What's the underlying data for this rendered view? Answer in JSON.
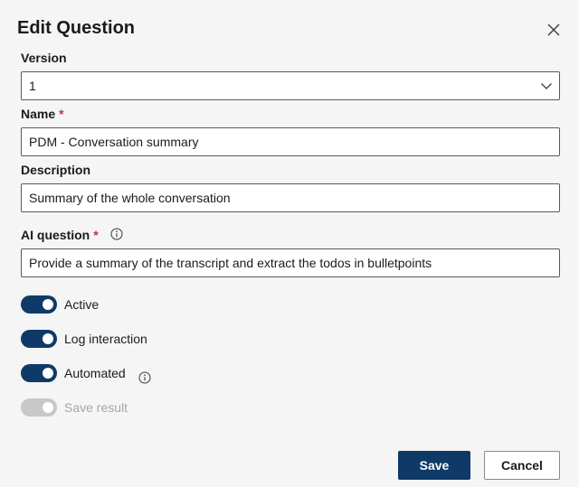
{
  "dialog": {
    "title": "Edit Question",
    "close_icon": "close-icon"
  },
  "version": {
    "label": "Version",
    "value": "1"
  },
  "name": {
    "label": "Name",
    "required_marker": "*",
    "value": "PDM - Conversation summary"
  },
  "description": {
    "label": "Description",
    "value": "Summary of the whole conversation"
  },
  "ai_question": {
    "label": "AI question",
    "required_marker": "*",
    "info_icon": "info-icon",
    "value": "Provide a summary of the transcript and extract the todos in bulletpoints"
  },
  "toggles": [
    {
      "label": "Active",
      "on": true,
      "disabled": false
    },
    {
      "label": "Log interaction",
      "on": true,
      "disabled": false
    },
    {
      "label": "Automated",
      "on": true,
      "disabled": false,
      "info_icon": "info-icon"
    },
    {
      "label": "Save result",
      "on": true,
      "disabled": true
    }
  ],
  "buttons": {
    "save_label": "Save",
    "cancel_label": "Cancel"
  },
  "colors": {
    "accent": "#0f3a68",
    "required": "#c4314b",
    "background": "#f5f5f5",
    "disabled_toggle": "#c8c8c8"
  }
}
